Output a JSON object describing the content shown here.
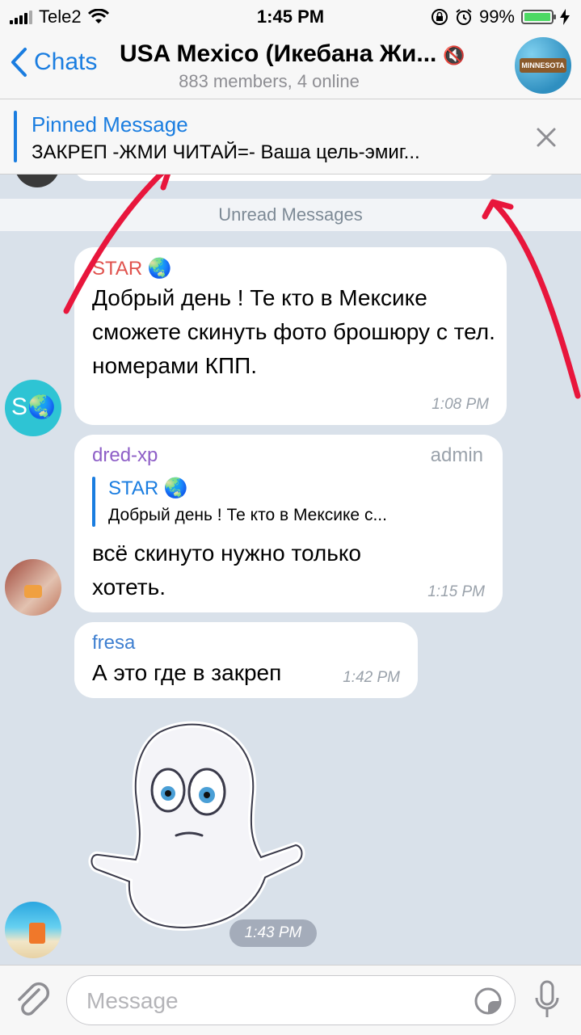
{
  "status_bar": {
    "carrier": "Tele2",
    "time": "1:45 PM",
    "battery": "99%",
    "battery_level": 0.99,
    "icons": [
      "signal-icon",
      "wifi-icon",
      "rotation-lock-icon",
      "alarm-icon",
      "battery-icon",
      "charging-icon"
    ]
  },
  "nav": {
    "back_label": "Chats",
    "title": "USA Mexico (Икебана Жи...",
    "subtitle": "883 members, 4 online",
    "avatar_text": "MINNESOTA"
  },
  "pinned": {
    "title": "Pinned Message",
    "text": "ЗАКРЕП -ЖМИ ЧИТАЙ=- Ваша цель-эмиг..."
  },
  "unread_label": "Unread Messages",
  "messages": [
    {
      "sender": "STAR 🌏",
      "text": "Добрый день ! Те кто в Мексике сможете скинуть фото брошюру с  тел. номерами КПП.",
      "time": "1:08 PM",
      "avatar_letter": "S",
      "sender_color": "#e0524d"
    },
    {
      "sender": "dred-xp",
      "role": "admin",
      "reply_sender": "STAR 🌏",
      "reply_text": "Добрый день ! Те кто в Мексике  с...",
      "text": "всё скинуто нужно только хотеть.",
      "time": "1:15 PM",
      "sender_color": "#8e5fc7"
    },
    {
      "sender": "fresa",
      "text": "А это где в закреп",
      "time": "1:42 PM",
      "sender_color": "#3e7fd0"
    },
    {
      "type": "sticker",
      "time": "1:43 PM"
    }
  ],
  "input": {
    "placeholder": "Message",
    "value": ""
  },
  "colors": {
    "accent": "#1a7de0",
    "chat_bg": "#d9e1ea",
    "annotation": "#e8163c"
  }
}
